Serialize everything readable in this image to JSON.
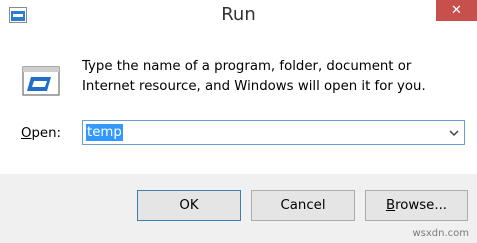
{
  "window": {
    "title": "Run",
    "close_label": "✕",
    "app_icon": "run-window-icon"
  },
  "body": {
    "icon": "run-program-icon",
    "description": "Type the name of a program, folder, document or Internet resource, and Windows will open it for you.",
    "open_label_mnemonic": "O",
    "open_label_rest": "pen:",
    "open_value": "temp"
  },
  "buttons": {
    "ok": "OK",
    "cancel": "Cancel",
    "browse_mnemonic": "B",
    "browse_rest": "rowse..."
  },
  "watermark": "wsxdn.com",
  "colors": {
    "close": "#c7504d",
    "selection": "#3399ff",
    "focus_border": "#6b9fd4"
  }
}
